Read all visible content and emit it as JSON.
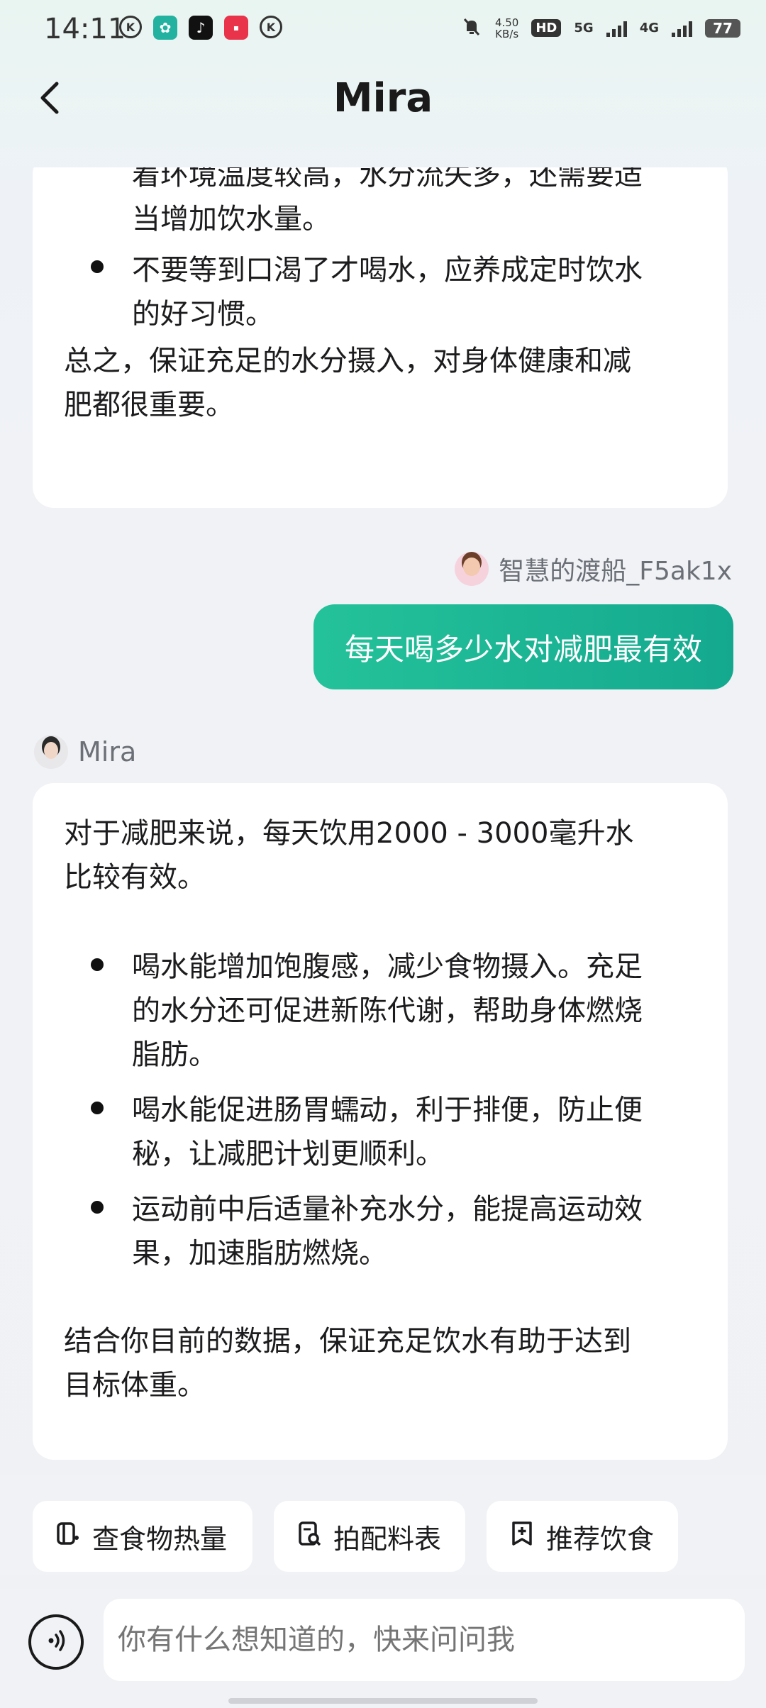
{
  "status_bar": {
    "time": "14:11",
    "net_speed": "4.50",
    "net_unit": "KB/s",
    "hd": "HD",
    "sig1": "5G",
    "sig2": "4G",
    "battery": "77"
  },
  "header": {
    "title": "Mira"
  },
  "messages": {
    "prev_ai": {
      "bullet1_line1": "着环境温度较高，水分流失多，还需要适",
      "bullet1_line2": "当增加饮水量。",
      "bullet2_line1": "不要等到口渴了才喝水，应养成定时饮水",
      "bullet2_line2": "的好习惯。",
      "summary_line1": "总之，保证充足的水分摄入，对身体健康和减",
      "summary_line2": "肥都很重要。"
    },
    "user": {
      "name": "智慧的渡船_F5ak1x",
      "text": "每天喝多少水对减肥最有效"
    },
    "ai": {
      "name": "Mira",
      "intro_line1": "对于减肥来说，每天饮用2000 - 3000毫升水",
      "intro_line2": "比较有效。",
      "b1_l1": "喝水能增加饱腹感，减少食物摄入。充足",
      "b1_l2": "的水分还可促进新陈代谢，帮助身体燃烧",
      "b1_l3": "脂肪。",
      "b2_l1": "喝水能促进肠胃蠕动，利于排便，防止便",
      "b2_l2": "秘，让减肥计划更顺利。",
      "b3_l1": "运动前中后适量补充水分，能提高运动效",
      "b3_l2": "果，加速脂肪燃烧。",
      "end_line1": "结合你目前的数据，保证充足饮水有助于达到",
      "end_line2": "目标体重。"
    }
  },
  "quick_actions": {
    "food_calories": "查食物热量",
    "scan_ingredients": "拍配料表",
    "recommend_diet": "推荐饮食"
  },
  "input": {
    "placeholder": "你有什么想知道的，快来问问我"
  }
}
